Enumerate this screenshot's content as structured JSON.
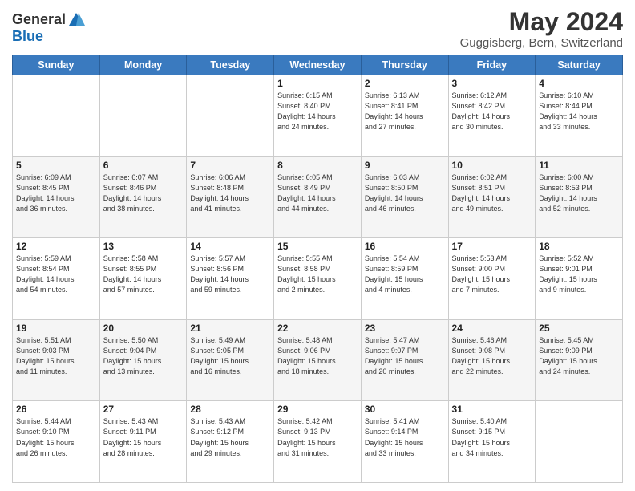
{
  "header": {
    "logo_line1": "General",
    "logo_line2": "Blue",
    "month_title": "May 2024",
    "location": "Guggisberg, Bern, Switzerland"
  },
  "weekdays": [
    "Sunday",
    "Monday",
    "Tuesday",
    "Wednesday",
    "Thursday",
    "Friday",
    "Saturday"
  ],
  "weeks": [
    [
      {
        "day": "",
        "info": ""
      },
      {
        "day": "",
        "info": ""
      },
      {
        "day": "",
        "info": ""
      },
      {
        "day": "1",
        "info": "Sunrise: 6:15 AM\nSunset: 8:40 PM\nDaylight: 14 hours\nand 24 minutes."
      },
      {
        "day": "2",
        "info": "Sunrise: 6:13 AM\nSunset: 8:41 PM\nDaylight: 14 hours\nand 27 minutes."
      },
      {
        "day": "3",
        "info": "Sunrise: 6:12 AM\nSunset: 8:42 PM\nDaylight: 14 hours\nand 30 minutes."
      },
      {
        "day": "4",
        "info": "Sunrise: 6:10 AM\nSunset: 8:44 PM\nDaylight: 14 hours\nand 33 minutes."
      }
    ],
    [
      {
        "day": "5",
        "info": "Sunrise: 6:09 AM\nSunset: 8:45 PM\nDaylight: 14 hours\nand 36 minutes."
      },
      {
        "day": "6",
        "info": "Sunrise: 6:07 AM\nSunset: 8:46 PM\nDaylight: 14 hours\nand 38 minutes."
      },
      {
        "day": "7",
        "info": "Sunrise: 6:06 AM\nSunset: 8:48 PM\nDaylight: 14 hours\nand 41 minutes."
      },
      {
        "day": "8",
        "info": "Sunrise: 6:05 AM\nSunset: 8:49 PM\nDaylight: 14 hours\nand 44 minutes."
      },
      {
        "day": "9",
        "info": "Sunrise: 6:03 AM\nSunset: 8:50 PM\nDaylight: 14 hours\nand 46 minutes."
      },
      {
        "day": "10",
        "info": "Sunrise: 6:02 AM\nSunset: 8:51 PM\nDaylight: 14 hours\nand 49 minutes."
      },
      {
        "day": "11",
        "info": "Sunrise: 6:00 AM\nSunset: 8:53 PM\nDaylight: 14 hours\nand 52 minutes."
      }
    ],
    [
      {
        "day": "12",
        "info": "Sunrise: 5:59 AM\nSunset: 8:54 PM\nDaylight: 14 hours\nand 54 minutes."
      },
      {
        "day": "13",
        "info": "Sunrise: 5:58 AM\nSunset: 8:55 PM\nDaylight: 14 hours\nand 57 minutes."
      },
      {
        "day": "14",
        "info": "Sunrise: 5:57 AM\nSunset: 8:56 PM\nDaylight: 14 hours\nand 59 minutes."
      },
      {
        "day": "15",
        "info": "Sunrise: 5:55 AM\nSunset: 8:58 PM\nDaylight: 15 hours\nand 2 minutes."
      },
      {
        "day": "16",
        "info": "Sunrise: 5:54 AM\nSunset: 8:59 PM\nDaylight: 15 hours\nand 4 minutes."
      },
      {
        "day": "17",
        "info": "Sunrise: 5:53 AM\nSunset: 9:00 PM\nDaylight: 15 hours\nand 7 minutes."
      },
      {
        "day": "18",
        "info": "Sunrise: 5:52 AM\nSunset: 9:01 PM\nDaylight: 15 hours\nand 9 minutes."
      }
    ],
    [
      {
        "day": "19",
        "info": "Sunrise: 5:51 AM\nSunset: 9:03 PM\nDaylight: 15 hours\nand 11 minutes."
      },
      {
        "day": "20",
        "info": "Sunrise: 5:50 AM\nSunset: 9:04 PM\nDaylight: 15 hours\nand 13 minutes."
      },
      {
        "day": "21",
        "info": "Sunrise: 5:49 AM\nSunset: 9:05 PM\nDaylight: 15 hours\nand 16 minutes."
      },
      {
        "day": "22",
        "info": "Sunrise: 5:48 AM\nSunset: 9:06 PM\nDaylight: 15 hours\nand 18 minutes."
      },
      {
        "day": "23",
        "info": "Sunrise: 5:47 AM\nSunset: 9:07 PM\nDaylight: 15 hours\nand 20 minutes."
      },
      {
        "day": "24",
        "info": "Sunrise: 5:46 AM\nSunset: 9:08 PM\nDaylight: 15 hours\nand 22 minutes."
      },
      {
        "day": "25",
        "info": "Sunrise: 5:45 AM\nSunset: 9:09 PM\nDaylight: 15 hours\nand 24 minutes."
      }
    ],
    [
      {
        "day": "26",
        "info": "Sunrise: 5:44 AM\nSunset: 9:10 PM\nDaylight: 15 hours\nand 26 minutes."
      },
      {
        "day": "27",
        "info": "Sunrise: 5:43 AM\nSunset: 9:11 PM\nDaylight: 15 hours\nand 28 minutes."
      },
      {
        "day": "28",
        "info": "Sunrise: 5:43 AM\nSunset: 9:12 PM\nDaylight: 15 hours\nand 29 minutes."
      },
      {
        "day": "29",
        "info": "Sunrise: 5:42 AM\nSunset: 9:13 PM\nDaylight: 15 hours\nand 31 minutes."
      },
      {
        "day": "30",
        "info": "Sunrise: 5:41 AM\nSunset: 9:14 PM\nDaylight: 15 hours\nand 33 minutes."
      },
      {
        "day": "31",
        "info": "Sunrise: 5:40 AM\nSunset: 9:15 PM\nDaylight: 15 hours\nand 34 minutes."
      },
      {
        "day": "",
        "info": ""
      }
    ]
  ]
}
